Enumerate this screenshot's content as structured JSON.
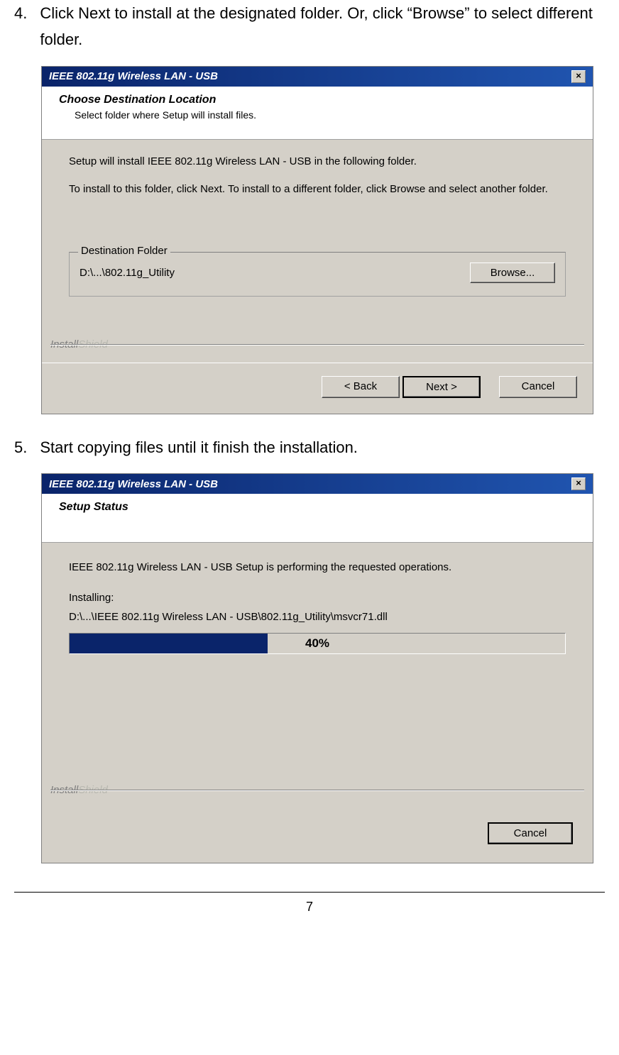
{
  "step4": {
    "num": "4.",
    "text": "Click Next to install at the designated folder. Or, click “Browse” to select different folder."
  },
  "step5": {
    "num": "5.",
    "text": "Start copying files until it finish the installation."
  },
  "dialog1": {
    "title": "IEEE 802.11g Wireless LAN - USB",
    "close": "×",
    "header_title": "Choose Destination Location",
    "header_sub": "Select folder where Setup will install files.",
    "body1": "Setup will install IEEE 802.11g Wireless LAN - USB in the following folder.",
    "body2": "To install to this folder, click Next. To install to a different folder, click Browse and select another folder.",
    "dest_legend": "Destination Folder",
    "dest_path": "D:\\...\\802.11g_Utility",
    "browse": "Browse...",
    "back": "< Back",
    "next": "Next >",
    "cancel": "Cancel"
  },
  "dialog2": {
    "title": "IEEE 802.11g Wireless LAN - USB",
    "close": "×",
    "header_title": "Setup Status",
    "body1": "IEEE 802.11g Wireless LAN - USB Setup is performing the requested operations.",
    "installing_label": "Installing:",
    "installing_path": "D:\\...\\IEEE 802.11g Wireless LAN - USB\\802.11g_Utility\\msvcr71.dll",
    "progress_pct": "40%",
    "cancel": "Cancel"
  },
  "installshield": {
    "dark": "Install",
    "light": "Shield"
  },
  "page_number": "7"
}
